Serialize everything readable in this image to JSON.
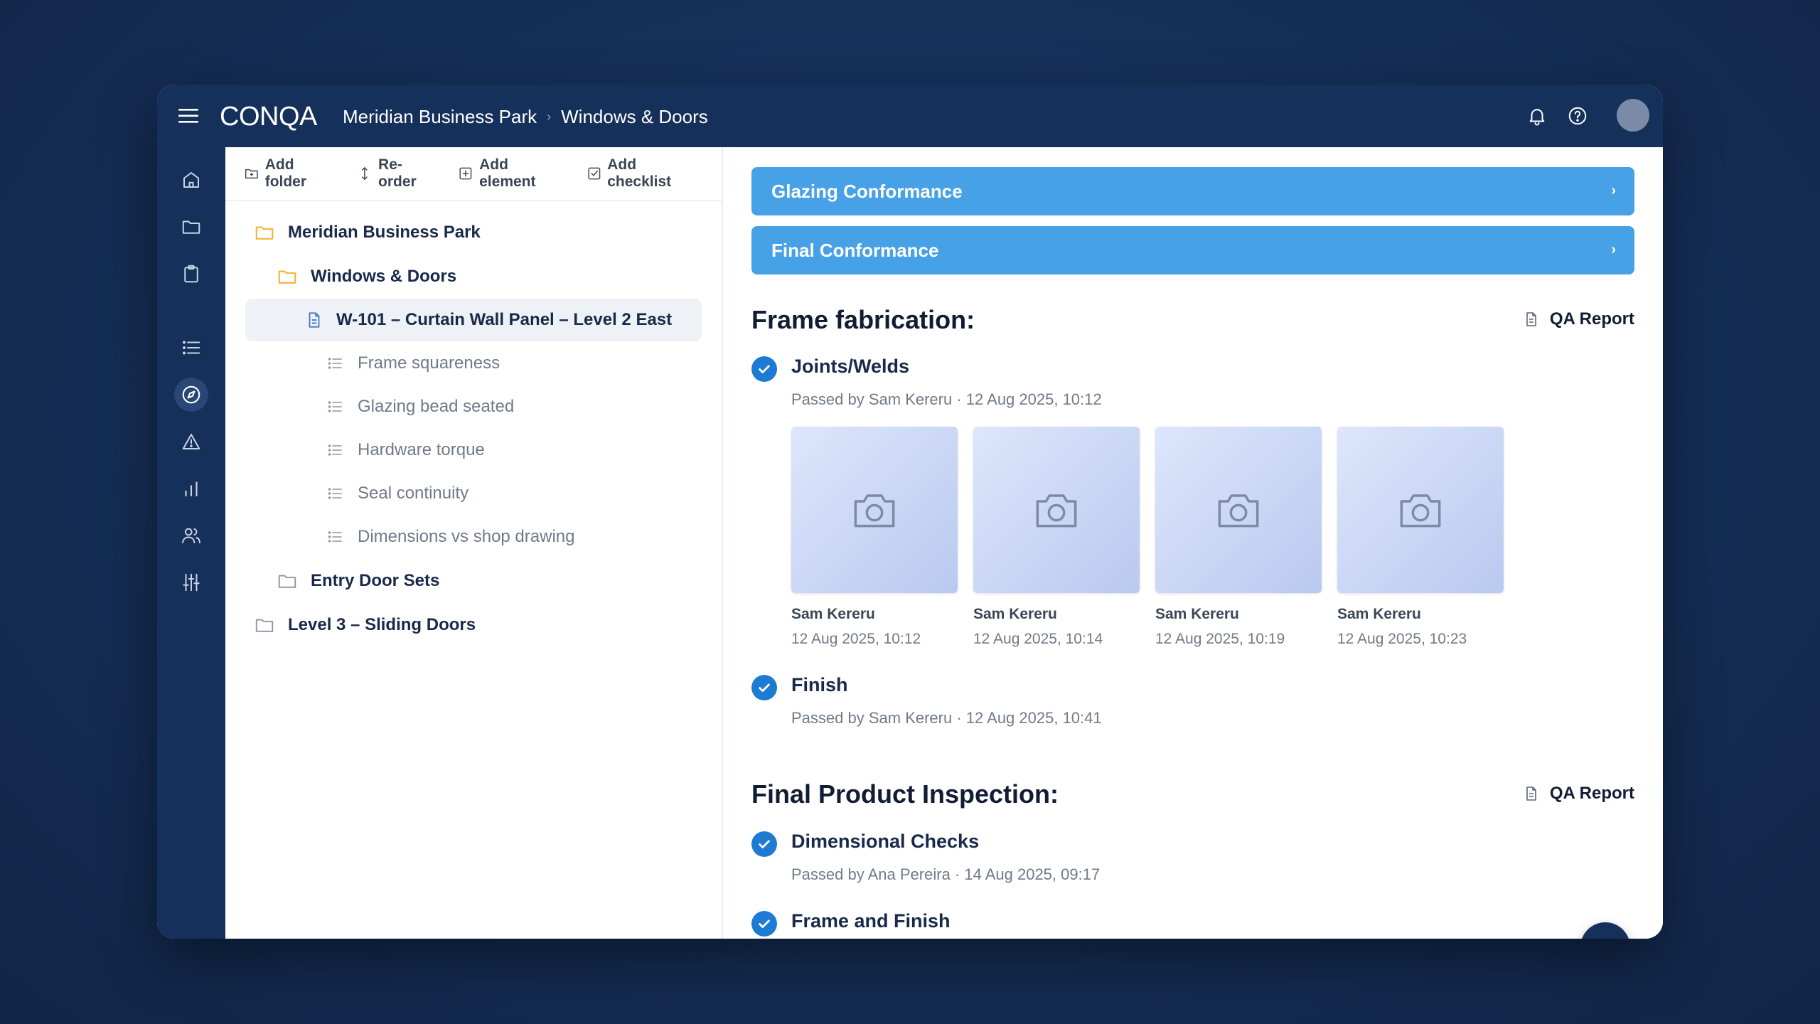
{
  "app": {
    "logo": "CONQA",
    "breadcrumb": [
      "Meridian Business Park",
      "Windows & Doors"
    ]
  },
  "toolbar": {
    "add_folder": "Add folder",
    "reorder": "Re-order",
    "add_element": "Add element",
    "add_checklist": "Add checklist"
  },
  "tree": {
    "root": "Meridian Business Park",
    "folder": "Windows & Doors",
    "selected": "W-101 – Curtain Wall Panel – Level 2 East",
    "items": [
      "Frame squareness",
      "Glazing bead seated",
      "Hardware torque",
      "Seal continuity",
      "Dimensions vs shop drawing"
    ],
    "sibling_folder": "Entry Door Sets",
    "root_sibling": "Level 3 – Sliding Doors"
  },
  "content": {
    "bars": [
      "Glazing Conformance",
      "Final Conformance"
    ],
    "sections": [
      {
        "title": "Frame fabrication:",
        "report": "QA Report",
        "checks": [
          {
            "title": "Joints/Welds",
            "passed": "Passed by Sam Kereru · 12 Aug 2025, 10:12",
            "photos": [
              {
                "name": "Sam Kereru",
                "date": "12 Aug 2025, 10:12"
              },
              {
                "name": "Sam Kereru",
                "date": "12 Aug 2025, 10:14"
              },
              {
                "name": "Sam Kereru",
                "date": "12 Aug 2025, 10:19"
              },
              {
                "name": "Sam Kereru",
                "date": "12 Aug 2025, 10:23"
              }
            ]
          },
          {
            "title": "Finish",
            "passed": "Passed by Sam Kereru · 12 Aug 2025, 10:41"
          }
        ]
      },
      {
        "title": "Final Product Inspection:",
        "report": "QA Report",
        "checks": [
          {
            "title": "Dimensional Checks",
            "passed": "Passed by Ana Pereira · 14 Aug 2025, 09:17"
          },
          {
            "title": "Frame and Finish"
          }
        ]
      }
    ]
  },
  "icons": {
    "rail": [
      "home-icon",
      "folder-icon",
      "clipboard-icon",
      "list-icon",
      "compass-icon",
      "warning-icon",
      "bar-chart-icon",
      "users-icon",
      "sliders-icon"
    ],
    "top": [
      "bell-icon",
      "help-icon"
    ]
  },
  "colors": {
    "navy": "#15305a",
    "accent_bar": "#46a1e6",
    "check": "#1e7bd4",
    "folder_yellow": "#f2b53a"
  }
}
